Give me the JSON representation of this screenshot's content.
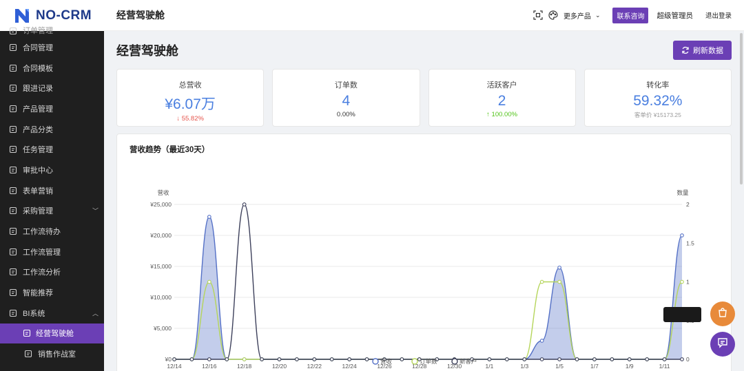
{
  "brand": {
    "name": "NO-CRM",
    "primary_color": "#6b3fb5",
    "accent_blue": "#4a7fe0"
  },
  "sidebar": {
    "items": [
      {
        "label": "订单管理",
        "icon": "order-icon"
      },
      {
        "label": "合同管理",
        "icon": "contract-icon"
      },
      {
        "label": "合同模板",
        "icon": "template-icon"
      },
      {
        "label": "跟进记录",
        "icon": "history-icon"
      },
      {
        "label": "产品管理",
        "icon": "product-icon"
      },
      {
        "label": "产品分类",
        "icon": "folder-icon"
      },
      {
        "label": "任务管理",
        "icon": "task-icon"
      },
      {
        "label": "审批中心",
        "icon": "approve-icon"
      },
      {
        "label": "表单营销",
        "icon": "form-icon"
      },
      {
        "label": "采购管理",
        "icon": "purchase-icon",
        "caret": "﹀"
      },
      {
        "label": "工作流待办",
        "icon": "workflow-todo-icon"
      },
      {
        "label": "工作流管理",
        "icon": "workflow-icon"
      },
      {
        "label": "工作流分析",
        "icon": "analysis-icon"
      },
      {
        "label": "智能推荐",
        "icon": "recommend-icon"
      },
      {
        "label": "BI系统",
        "icon": "bi-icon",
        "caret": "︿"
      },
      {
        "label": "经营驾驶舱",
        "icon": "dashboard-icon",
        "active": true
      },
      {
        "label": "销售作战室",
        "icon": "flag-icon"
      }
    ]
  },
  "header": {
    "title": "经营驾驶舱",
    "more_products": "更多产品",
    "contact": "联系咨询",
    "user": "超级管理员",
    "logout": "退出登录"
  },
  "page": {
    "title": "经营驾驶舱",
    "refresh_label": "刷新数据"
  },
  "stats": [
    {
      "label": "总营收",
      "value": "¥6.07万",
      "sub": "↓ 55.82%",
      "trend": "down"
    },
    {
      "label": "订单数",
      "value": "4",
      "sub": "0.00%",
      "trend": "neutral"
    },
    {
      "label": "活跃客户",
      "value": "2",
      "sub": "↑ 100.00%",
      "trend": "up"
    },
    {
      "label": "转化率",
      "value": "59.32%",
      "sub": "客单价 ¥15173.25",
      "trend": "muted"
    }
  ],
  "chart_data": {
    "type": "line",
    "title": "营收趋势（最近30天）",
    "ylabel": "营收",
    "y2label": "数量",
    "ylim": [
      0,
      25000
    ],
    "y2lim": [
      0,
      2
    ],
    "y_ticks": [
      "¥0",
      "¥5,000",
      "¥10,000",
      "¥15,000",
      "¥20,000",
      "¥25,000"
    ],
    "y2_ticks": [
      "0",
      "0.5",
      "1",
      "1.5",
      "2"
    ],
    "x_tick_labels": [
      "12/14",
      "12/16",
      "12/18",
      "12/20",
      "12/22",
      "12/24",
      "12/26",
      "12/28",
      "12/30",
      "1/1",
      "1/3",
      "1/5",
      "1/7",
      "1/9",
      "1/11"
    ],
    "categories": [
      "12/14",
      "12/15",
      "12/16",
      "12/17",
      "12/18",
      "12/19",
      "12/20",
      "12/21",
      "12/22",
      "12/23",
      "12/24",
      "12/25",
      "12/26",
      "12/27",
      "12/28",
      "12/29",
      "12/30",
      "12/31",
      "1/1",
      "1/2",
      "1/3",
      "1/4",
      "1/5",
      "1/6",
      "1/7",
      "1/8",
      "1/9",
      "1/10",
      "1/11",
      "1/12"
    ],
    "legend": [
      "营收",
      "订单数",
      "新客户"
    ],
    "legend_position": "bottom",
    "series": [
      {
        "name": "营收",
        "axis": "left",
        "color": "#5470c6",
        "fill": true,
        "values": [
          0,
          0,
          23000,
          0,
          0,
          0,
          0,
          0,
          0,
          0,
          0,
          0,
          0,
          0,
          0,
          0,
          0,
          0,
          0,
          0,
          0,
          3000,
          14800,
          0,
          0,
          0,
          0,
          0,
          0,
          20000
        ]
      },
      {
        "name": "订单数",
        "axis": "right",
        "color": "#b5d55a",
        "fill": false,
        "values": [
          0,
          0,
          1,
          0,
          0,
          0,
          0,
          0,
          0,
          0,
          0,
          0,
          0,
          0,
          0,
          0,
          0,
          0,
          0,
          0,
          0,
          1,
          1,
          0,
          0,
          0,
          0,
          0,
          0,
          1
        ]
      },
      {
        "name": "新客户",
        "axis": "right",
        "color": "#3c3f5a",
        "fill": false,
        "values": [
          0,
          0,
          0,
          0,
          2,
          0,
          0,
          0,
          0,
          0,
          0,
          0,
          0,
          0,
          0,
          0,
          0,
          0,
          0,
          0,
          0,
          0,
          0,
          0,
          0,
          0,
          0,
          0,
          0,
          0
        ]
      }
    ]
  }
}
